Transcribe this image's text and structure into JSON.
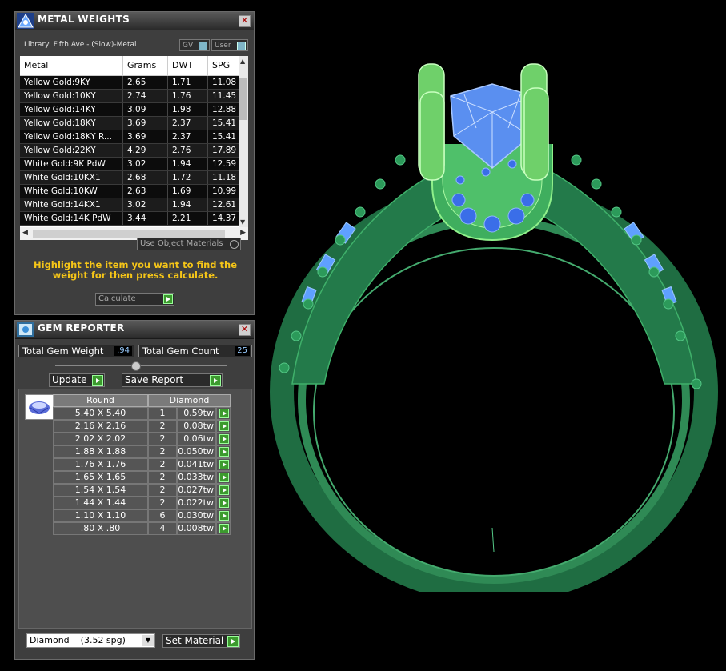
{
  "metal_weights": {
    "title": "METAL WEIGHTS",
    "library": "Library: Fifth Ave - (Slow)-Metal",
    "toggle_gv": "GV",
    "toggle_user": "User",
    "columns": [
      "Metal",
      "Grams",
      "DWT",
      "SPG"
    ],
    "rows": [
      [
        "Yellow Gold:9KY",
        "2.65",
        "1.71",
        "11.08"
      ],
      [
        "Yellow Gold:10KY",
        "2.74",
        "1.76",
        "11.45"
      ],
      [
        "Yellow Gold:14KY",
        "3.09",
        "1.98",
        "12.88"
      ],
      [
        "Yellow Gold:18KY",
        "3.69",
        "2.37",
        "15.41"
      ],
      [
        "Yellow Gold:18KY R...",
        "3.69",
        "2.37",
        "15.41"
      ],
      [
        "Yellow Gold:22KY",
        "4.29",
        "2.76",
        "17.89"
      ],
      [
        "White Gold:9K PdW",
        "3.02",
        "1.94",
        "12.59"
      ],
      [
        "White Gold:10KX1",
        "2.68",
        "1.72",
        "11.18"
      ],
      [
        "White Gold:10KW",
        "2.63",
        "1.69",
        "10.99"
      ],
      [
        "White Gold:14KX1",
        "3.02",
        "1.94",
        "12.61"
      ],
      [
        "White Gold:14K PdW",
        "3.44",
        "2.21",
        "14.37"
      ]
    ],
    "use_object_materials": "Use Object Materials",
    "instruction": "Highlight the item you want to find the weight for then press calculate.",
    "calculate": "Calculate"
  },
  "gem_reporter": {
    "title": "GEM REPORTER",
    "total_gem_weight_label": "Total Gem Weight",
    "total_gem_weight": ".94",
    "total_gem_count_label": "Total Gem Count",
    "total_gem_count": "25",
    "update": "Update",
    "save_report": "Save Report",
    "col_shape": "Round",
    "col_material": "Diamond",
    "rows": [
      [
        "5.40 X 5.40",
        "1",
        "0.59tw"
      ],
      [
        "2.16 X 2.16",
        "2",
        "0.08tw"
      ],
      [
        "2.02 X 2.02",
        "2",
        "0.06tw"
      ],
      [
        "1.88 X 1.88",
        "2",
        "0.050tw"
      ],
      [
        "1.76 X 1.76",
        "2",
        "0.041tw"
      ],
      [
        "1.65 X 1.65",
        "2",
        "0.033tw"
      ],
      [
        "1.54 X 1.54",
        "2",
        "0.027tw"
      ],
      [
        "1.44 X 1.44",
        "2",
        "0.022tw"
      ],
      [
        "1.10 X 1.10",
        "6",
        "0.030tw"
      ],
      [
        ".80 X .80",
        "4",
        "0.008tw"
      ]
    ],
    "material_select": "Diamond    (3.52 spg)",
    "set_material": "Set Material"
  },
  "colors": {
    "ring_green": "#2f8a55",
    "prong_green": "#6fd06a",
    "gem_blue": "#4a8ff0",
    "warning_yellow": "#f5c518"
  }
}
